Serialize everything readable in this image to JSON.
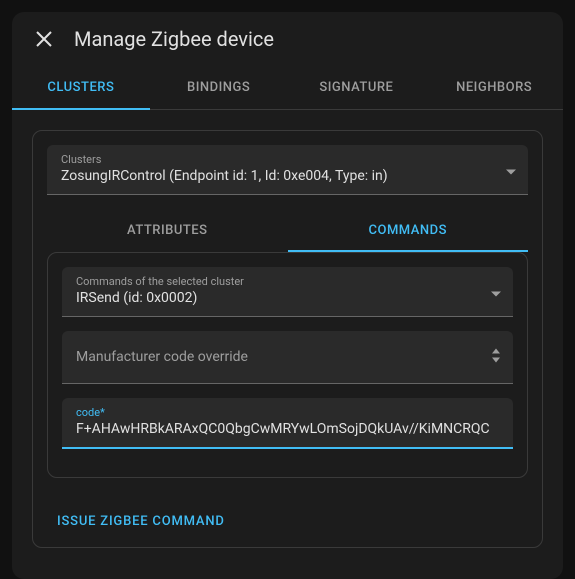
{
  "dialog": {
    "title": "Manage Zigbee device"
  },
  "tabs": [
    {
      "label": "CLUSTERS",
      "active": true
    },
    {
      "label": "BINDINGS",
      "active": false
    },
    {
      "label": "SIGNATURE",
      "active": false
    },
    {
      "label": "NEIGHBORS",
      "active": false
    }
  ],
  "clusters_select": {
    "label": "Clusters",
    "value": "ZosungIRControl (Endpoint id: 1, Id: 0xe004, Type: in)"
  },
  "inner_tabs": [
    {
      "label": "ATTRIBUTES",
      "active": false
    },
    {
      "label": "COMMANDS",
      "active": true
    }
  ],
  "commands_select": {
    "label": "Commands of the selected cluster",
    "value": "IRSend (id: 0x0002)"
  },
  "manufacturer_field": {
    "placeholder": "Manufacturer code override"
  },
  "code_field": {
    "label": "code*",
    "value": "F+AHAwHRBkARAxQC0QbgCwMRYwLOmSojDQkUAv//KiMNCRQC"
  },
  "action_button": {
    "label": "ISSUE ZIGBEE COMMAND"
  }
}
